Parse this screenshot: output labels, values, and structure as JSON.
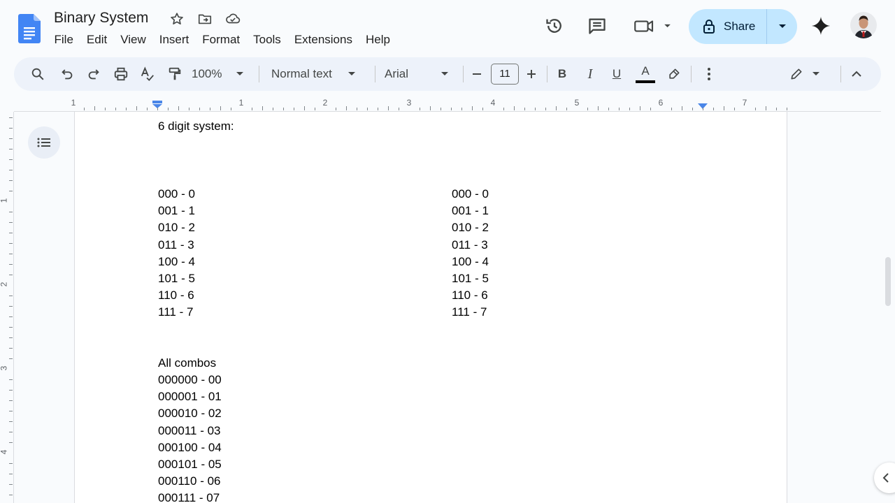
{
  "document": {
    "title": "Binary System"
  },
  "menu": [
    "File",
    "Edit",
    "View",
    "Insert",
    "Format",
    "Tools",
    "Extensions",
    "Help"
  ],
  "share": {
    "label": "Share"
  },
  "toolbar": {
    "zoom": "100%",
    "style": "Normal text",
    "font": "Arial",
    "font_size": "11",
    "bold": "B",
    "italic": "I",
    "underline": "U",
    "text_color": "A"
  },
  "ruler": {
    "numbers": [
      "1",
      "1",
      "2",
      "3",
      "4",
      "5",
      "6",
      "7"
    ],
    "vertical_numbers": [
      "1",
      "2",
      "3",
      "4"
    ]
  },
  "content": {
    "heading": "6 digit system:",
    "left_column": [
      "000 - 0",
      "001 - 1",
      "010 - 2",
      "011 - 3",
      "100 - 4",
      "101 - 5",
      "110 - 6",
      "111 - 7"
    ],
    "right_column": [
      "000 - 0",
      "001 - 1",
      "010 - 2",
      "011 - 3",
      "100 - 4",
      "101 - 5",
      "110 - 6",
      "111 - 7"
    ],
    "combos_heading": "All combos",
    "combos": [
      "000000 - 00",
      "000001 - 01",
      "000010 - 02",
      "000011 - 03",
      "000100 - 04",
      "000101 - 05",
      "000110 - 06",
      "000111 - 07"
    ]
  },
  "colors": {
    "docs_blue": "#4285f4",
    "share_bg": "#c2e7ff",
    "toolbar_bg": "#edf2fa",
    "ruler_marker": "#4a86e8"
  }
}
